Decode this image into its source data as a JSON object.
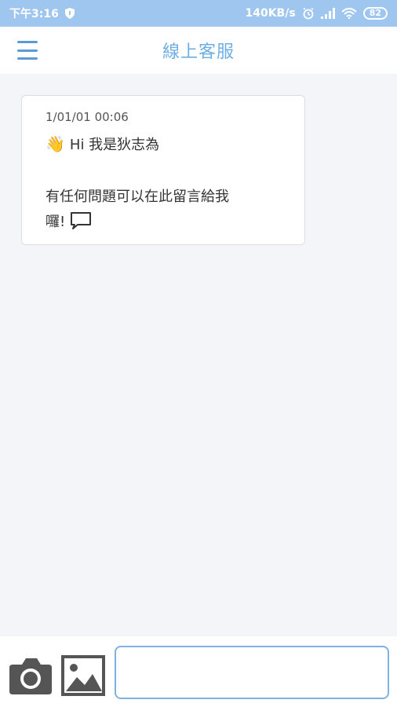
{
  "status_bar": {
    "time": "下午3:16",
    "network_speed": "140KB/s",
    "battery": "82"
  },
  "header": {
    "title": "線上客服"
  },
  "messages": [
    {
      "timestamp": "1/01/01 00:06",
      "greeting": "Hi 我是狄志為",
      "body_line1": "有任何問題可以在此留言給我",
      "body_line2": "囉!"
    }
  ],
  "composer": {
    "input_value": "",
    "placeholder": ""
  },
  "icons": [
    "shield-icon",
    "alarm-icon",
    "signal-icon",
    "wifi-icon",
    "battery-icon",
    "menu-icon",
    "wave-icon",
    "speech-bubble-icon",
    "camera-icon",
    "image-icon"
  ]
}
